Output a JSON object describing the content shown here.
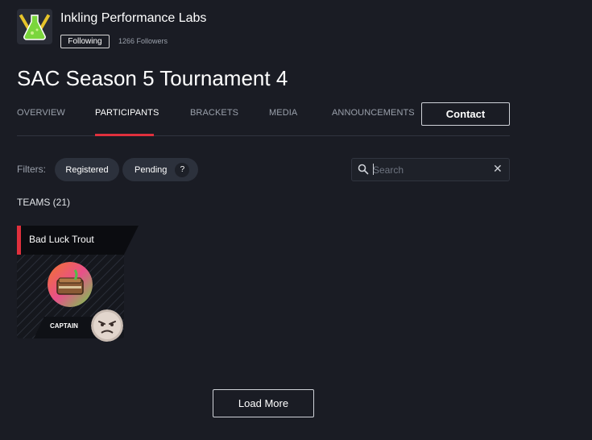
{
  "org": {
    "name": "Inkling Performance Labs",
    "follow_label": "Following",
    "followers": "1266 Followers",
    "logo_icon": "flask-logo-icon"
  },
  "page": {
    "title": "SAC Season 5 Tournament 4"
  },
  "tabs": [
    {
      "label": "OVERVIEW",
      "active": false
    },
    {
      "label": "PARTICIPANTS",
      "active": true
    },
    {
      "label": "BRACKETS",
      "active": false
    },
    {
      "label": "MEDIA",
      "active": false
    },
    {
      "label": "ANNOUNCEMENTS",
      "active": false
    }
  ],
  "contact_label": "Contact",
  "filters": {
    "label": "Filters:",
    "registered": "Registered",
    "pending": "Pending",
    "help": "?"
  },
  "search": {
    "placeholder": "Search",
    "icon": "search-icon",
    "clear": "✕"
  },
  "teams": {
    "count_label": "TEAMS (21)",
    "items": [
      {
        "name": "Bad Luck Trout",
        "captain_label": "CAPTAIN"
      }
    ]
  },
  "load_more_label": "Load More",
  "colors": {
    "background": "#1a1c24",
    "accent": "#e0303d",
    "pill": "#2c313c"
  }
}
